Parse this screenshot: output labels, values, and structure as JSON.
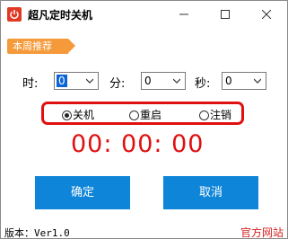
{
  "window": {
    "title": "超凡定时关机"
  },
  "tag": {
    "label": "本周推荐"
  },
  "time": {
    "hour_label": "时:",
    "hour_value": "0",
    "minute_label": "分:",
    "minute_value": "0",
    "second_label": "秒:",
    "second_value": "0"
  },
  "modes": [
    {
      "label": "关机",
      "selected": true
    },
    {
      "label": "重启",
      "selected": false
    },
    {
      "label": "注销",
      "selected": false
    }
  ],
  "countdown": {
    "text": "00: 00: 00"
  },
  "buttons": {
    "ok": "确定",
    "cancel": "取消"
  },
  "footer": {
    "version": "版本：Ver1.0",
    "site": "官方网站"
  },
  "colors": {
    "accent_blue": "#0e85d8",
    "alert_red": "#e01010",
    "tag_orange": "#f59a3a"
  },
  "icons": {
    "app": "power-icon",
    "minimize": "minimize-icon",
    "maximize": "maximize-icon",
    "close": "close-icon"
  }
}
